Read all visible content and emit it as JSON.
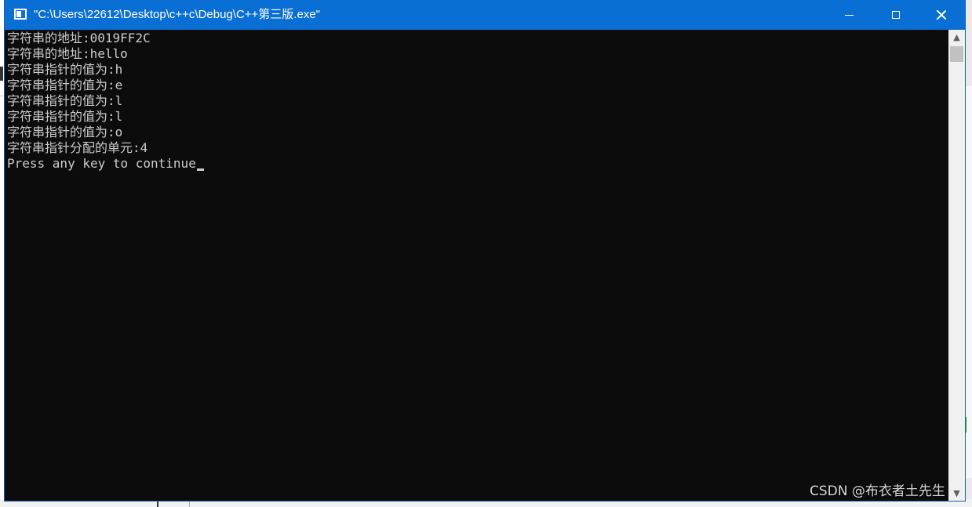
{
  "window": {
    "title": "\"C:\\Users\\22612\\Desktop\\c++c\\Debug\\C++第三版.exe\"",
    "minimize_icon": "minimize-icon",
    "maximize_icon": "maximize-icon",
    "close_icon": "close-icon"
  },
  "console": {
    "lines": [
      "字符串的地址:0019FF2C",
      "字符串的地址:hello",
      "字符串指针的值为:h",
      "字符串指针的值为:e",
      "字符串指针的值为:l",
      "字符串指针的值为:l",
      "字符串指针的值为:o",
      "字符串指针分配的单元:4",
      "Press any key to continue"
    ]
  },
  "scrollbar": {
    "up_arrow": "▲",
    "down_arrow": "▼"
  },
  "watermark": "CSDN @布衣者土先生",
  "colors": {
    "titlebar": "#0a6fd4",
    "console_bg": "#0c0c0c",
    "console_text": "#cccccc"
  }
}
